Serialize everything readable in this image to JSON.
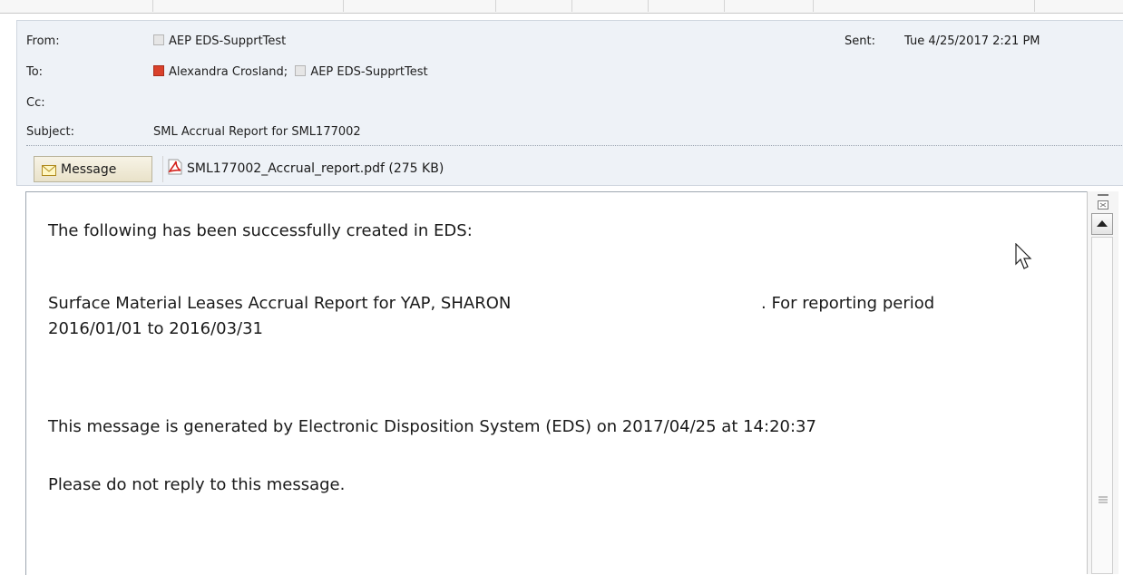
{
  "header": {
    "from_label": "From:",
    "from_value": "AEP EDS-SupprtTest",
    "to_label": "To:",
    "to_recipients": [
      {
        "name": "Alexandra Crosland;",
        "status": "busy"
      },
      {
        "name": "AEP EDS-SupprtTest",
        "status": "unknown"
      }
    ],
    "cc_label": "Cc:",
    "subject_label": "Subject:",
    "subject_value": "SML Accrual Report for SML177002",
    "sent_label": "Sent:",
    "sent_value": "Tue 4/25/2017 2:21 PM"
  },
  "tabs": {
    "message_label": "Message",
    "attachment_label": "SML177002_Accrual_report.pdf (275 KB)"
  },
  "body": {
    "line1": "The following has been successfully created in EDS:",
    "line2a": "Surface Material Leases Accrual Report for YAP, SHARON",
    "line2b": ". For reporting period",
    "line3": "2016/01/01 to 2016/03/31",
    "line4": "This message is generated by Electronic Disposition System (EDS) on 2017/04/25 at 14:20:37",
    "line5": "Please do not reply to this message."
  },
  "icons": {
    "presence_unknown": "presence-unknown-icon",
    "presence_busy": "presence-busy-icon",
    "message": "envelope-icon",
    "attachment": "pdf-icon",
    "cursor": "mouse-pointer-icon"
  },
  "colors": {
    "header_bg": "#eef2f7",
    "busy": "#d9412b",
    "pdf_red": "#d4221d"
  }
}
